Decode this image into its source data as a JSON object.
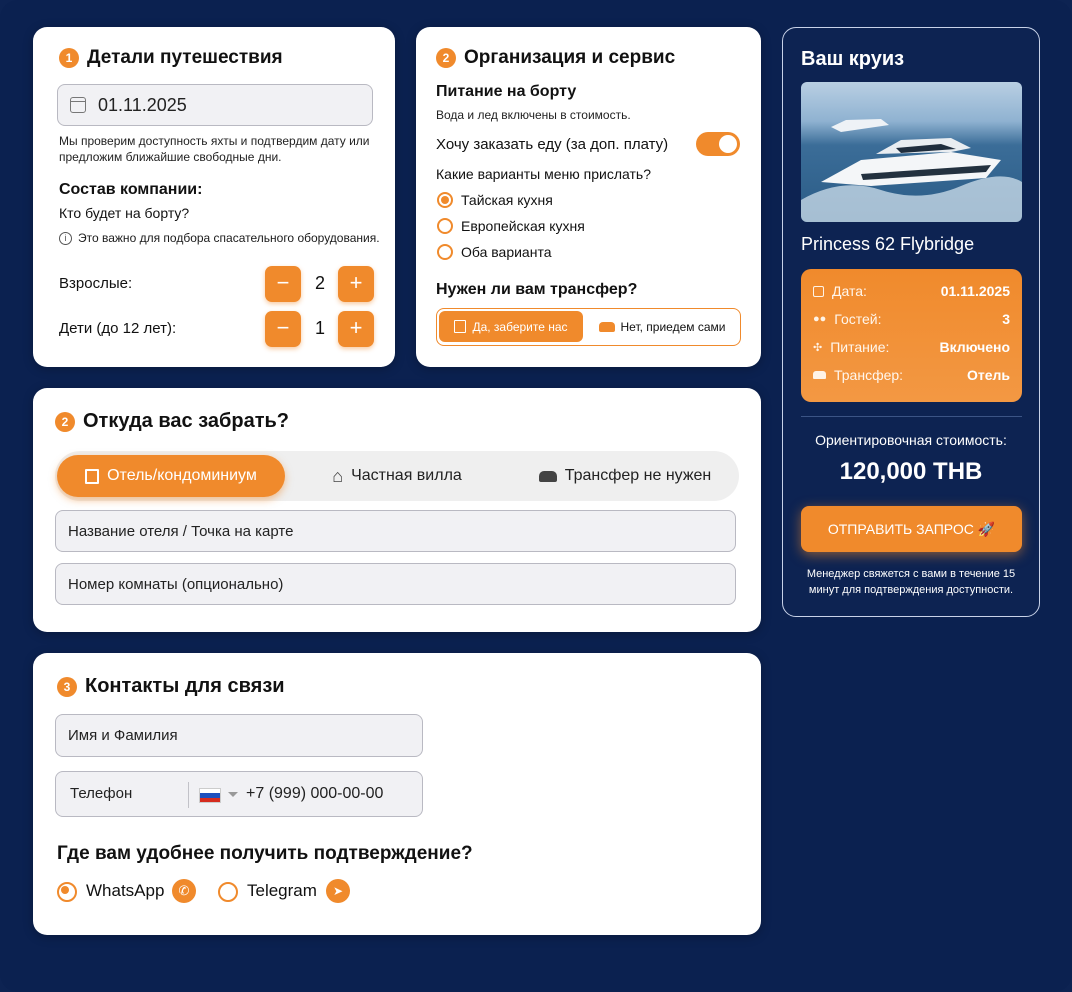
{
  "trip": {
    "step": "1",
    "title": "Детали путешествия",
    "date_value": "01.11.2025",
    "date_note": "Мы проверим доступность яхты и подтвердим дату или предложим ближайшие свободные дни.",
    "company_title": "Состав компании:",
    "company_question": "Кто будет на борту?",
    "safety_note": "Это важно для подбора спасательного оборудования.",
    "adults_label": "Взрослые:",
    "adults_value": "2",
    "kids_label": "Дети (до 12 лет):",
    "kids_value": "1",
    "minus": "−",
    "plus": "+"
  },
  "service": {
    "step": "2",
    "title": "Организация и сервис",
    "food_title": "Питание на борту",
    "food_note": "Вода и лед включены в стоимость.",
    "order_food_label": "Хочу заказать еду (за доп. плату)",
    "order_food_on": true,
    "menu_question": "Какие варианты меню прислать?",
    "menu_options": [
      "Тайская кухня",
      "Европейская кухня",
      "Оба варианта"
    ],
    "menu_selected": 0,
    "transfer_title": "Нужен ли вам трансфер?",
    "transfer_yes": "Да, заберите нас",
    "transfer_no": "Нет, приедем сами"
  },
  "pickup": {
    "step": "2",
    "title": "Откуда вас забрать?",
    "tabs": [
      "Отель/кондоминиум",
      "Частная вилла",
      "Трансфер не нужен"
    ],
    "active_tab": 0,
    "hotel_placeholder": "Название отеля / Точка на карте",
    "room_placeholder": "Номер комнаты (опционально)"
  },
  "contacts": {
    "step": "3",
    "title": "Контакты для связи",
    "name_placeholder": "Имя и Фамилия",
    "phone_label": "Телефон",
    "phone_placeholder": "+7 (999) 000-00-00",
    "confirm_question": "Где вам удобнее получить подтверждение?",
    "channels": [
      "WhatsApp",
      "Telegram"
    ],
    "channel_selected": 0
  },
  "summary": {
    "title": "Ваш круиз",
    "yacht_name": "Princess 62 Flybridge",
    "rows": [
      {
        "icon": "calendar-icon",
        "key": "Дата:",
        "value": "01.11.2025"
      },
      {
        "icon": "guests-icon",
        "key": "Гостей:",
        "value": "3"
      },
      {
        "icon": "food-icon",
        "key": "Питание:",
        "value": "Включено"
      },
      {
        "icon": "car-icon",
        "key": "Трансфер:",
        "value": "Отель"
      }
    ],
    "price_label": "Ориентировочная стоимость:",
    "price": "120,000 THB",
    "submit_label": "ОТПРАВИТЬ ЗАПРОС 🚀",
    "footer_note": "Менеджер свяжется с вами в течение 15 минут для подтверждения доступности."
  },
  "colors": {
    "accent": "#f08a2c",
    "background": "#0d2352",
    "card": "#ffffff"
  }
}
